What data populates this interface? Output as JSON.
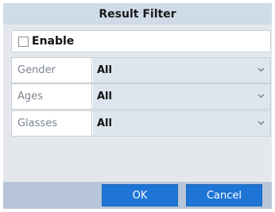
{
  "dialog": {
    "title": "Result Filter",
    "enable_label": "Enable",
    "enable_checked": false,
    "rows": [
      {
        "label": "Gender",
        "value": "All"
      },
      {
        "label": "Ages",
        "value": "All"
      },
      {
        "label": "Glasses",
        "value": "All"
      }
    ],
    "ok_label": "OK",
    "cancel_label": "Cancel"
  },
  "colors": {
    "titlebar": "#cfdbe6",
    "body": "#e4e8ec",
    "footer": "#b6c6d8",
    "button": "#1f75d6",
    "select_bg": "#dde6ee"
  },
  "icons": {
    "dropdown": "chevron-down-icon"
  }
}
